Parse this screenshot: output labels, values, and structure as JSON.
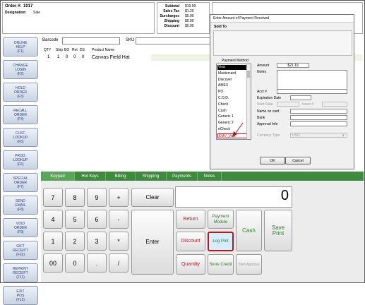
{
  "order": {
    "label": "Order #:",
    "number": "1017",
    "designation_label": "Designation:",
    "designation": "Sale"
  },
  "totals": {
    "rows": [
      {
        "label": "Subtotal",
        "value": "$19.99"
      },
      {
        "label": "Sales Tax",
        "value": "$1.20"
      },
      {
        "label": "Surcharges",
        "value": "$0.00"
      },
      {
        "label": "Shipping",
        "value": "$0.00"
      },
      {
        "label": "Discount",
        "value": "$0.00"
      }
    ]
  },
  "sidebar": [
    {
      "label": "ONLINE\nHELP\n(F1)"
    },
    {
      "label": "CHANGE\nLOGIN\n(F2)"
    },
    {
      "label": "HOLD\nORDER\n(F3)"
    },
    {
      "label": "RECALL\nORDER\n(F4)"
    },
    {
      "label": "CUST.\nLOOKUP\n(F5)"
    },
    {
      "label": "PROD.\nLOOKUP\n(F6)"
    },
    {
      "label": "SPECIAL\nORDER\n(F7)"
    },
    {
      "label": "SEND\nEMAIL\n(F8)"
    },
    {
      "label": "VOID\nORDER\n(F9)"
    },
    {
      "label": "GIFT\nRECEIPT\n(F10)"
    },
    {
      "label": "REPRINT\nRECEIPT\n(F11)"
    },
    {
      "label": "EXIT\nPOS\n(F12)"
    }
  ],
  "scan": {
    "barcode_label": "Barcode",
    "sku_label": "SKU"
  },
  "items": {
    "headers": [
      "QTY",
      "Ship",
      "BO",
      "Ret",
      "DS",
      "Product Name"
    ],
    "rows": [
      [
        "1",
        "1",
        "0",
        "0",
        "0",
        "Canvas Field Hat"
      ]
    ]
  },
  "tabs": [
    {
      "label": "Keypad"
    },
    {
      "label": "Hot Keys"
    },
    {
      "label": "Billing"
    },
    {
      "label": "Shipping"
    },
    {
      "label": "Payments"
    },
    {
      "label": "Notes"
    }
  ],
  "keypad": {
    "display": "0",
    "keys": [
      "7",
      "8",
      "9",
      "+",
      "4",
      "5",
      "6",
      "-",
      "1",
      "2",
      "3",
      "*",
      "00",
      "0",
      ".",
      "/"
    ],
    "clear": "Clear",
    "enter": "Enter"
  },
  "functions": {
    "return": "Return",
    "discount": "Discount",
    "quantity": "Quantity",
    "payment_module": "Payment Module",
    "log_pmt": "Log Pmt",
    "store_credit": "Store Credit",
    "start_approve": "Start Approve",
    "cash": "Cash",
    "save_print": "Save Print"
  },
  "dialog": {
    "title": "Enter Amount of Payment Received",
    "sold_to": "Sold To",
    "payment_method_label": "Payment Method",
    "methods": [
      "Visa",
      "Mastercard",
      "Discover",
      "AMEX",
      "PO",
      "C.O.D.",
      "Check",
      "Cash",
      "Generic 1",
      "Generic 2",
      "eCheck",
      "EMV_Visa"
    ],
    "selected_method": "Visa",
    "highlighted_method": "EMV_Visa",
    "amount_label": "Amount",
    "amount": "$21.19",
    "notes_label": "Notes",
    "acct_label": "Acct #",
    "exp_label": "Expiration Date",
    "start_label": "Start Date",
    "issue_label": "Issue #",
    "name_label": "Name on card",
    "bank_label": "Bank",
    "approval_label": "Approval Info",
    "currency_label": "Currency Type",
    "currency": "USD",
    "ok": "OK",
    "cancel": "Cancel"
  }
}
